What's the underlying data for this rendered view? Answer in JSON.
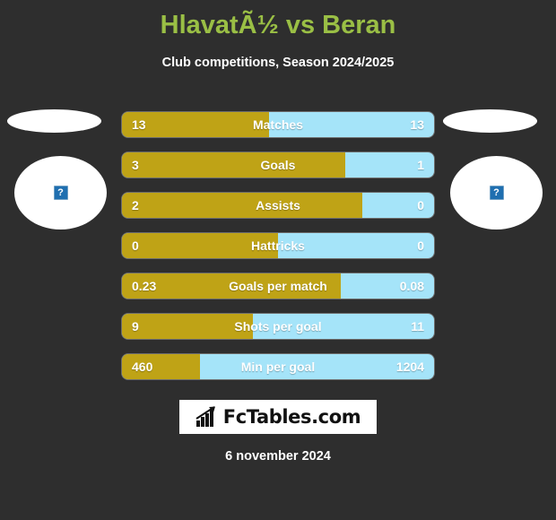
{
  "header": {
    "title": "HlavatÃ½ vs Beran",
    "subtitle": "Club competitions, Season 2024/2025"
  },
  "players": {
    "left": {
      "photo_placeholder": "broken-image-icon",
      "glyph": "?"
    },
    "right": {
      "photo_placeholder": "broken-image-icon",
      "glyph": "?"
    }
  },
  "colors": {
    "background": "#2e2e2e",
    "title": "#9abf45",
    "left_bar": "#bfa316",
    "right_bar": "#a5e4f9",
    "text": "#ffffff"
  },
  "footer": {
    "logo_text": "FcTables.com",
    "logo_icon": "bar-chart-arrow-icon",
    "date": "6 november 2024"
  },
  "chart_data": {
    "type": "bar",
    "title": "HlavatÃ½ vs Beran",
    "subtitle": "Club competitions, Season 2024/2025",
    "orientation": "horizontal-diverging",
    "series": [
      {
        "name": "HlavatÃ½",
        "side": "left",
        "color": "#bfa316"
      },
      {
        "name": "Beran",
        "side": "right",
        "color": "#a5e4f9"
      }
    ],
    "categories": [
      "Matches",
      "Goals",
      "Assists",
      "Hattricks",
      "Goals per match",
      "Shots per goal",
      "Min per goal"
    ],
    "rows": [
      {
        "label": "Matches",
        "left": "13",
        "right": "13",
        "left_pct": 47
      },
      {
        "label": "Goals",
        "left": "3",
        "right": "1",
        "left_pct": 71.5
      },
      {
        "label": "Assists",
        "left": "2",
        "right": "0",
        "left_pct": 77
      },
      {
        "label": "Hattricks",
        "left": "0",
        "right": "0",
        "left_pct": 50
      },
      {
        "label": "Goals per match",
        "left": "0.23",
        "right": "0.08",
        "left_pct": 70
      },
      {
        "label": "Shots per goal",
        "left": "9",
        "right": "11",
        "left_pct": 42
      },
      {
        "label": "Min per goal",
        "left": "460",
        "right": "1204",
        "left_pct": 25
      }
    ]
  }
}
